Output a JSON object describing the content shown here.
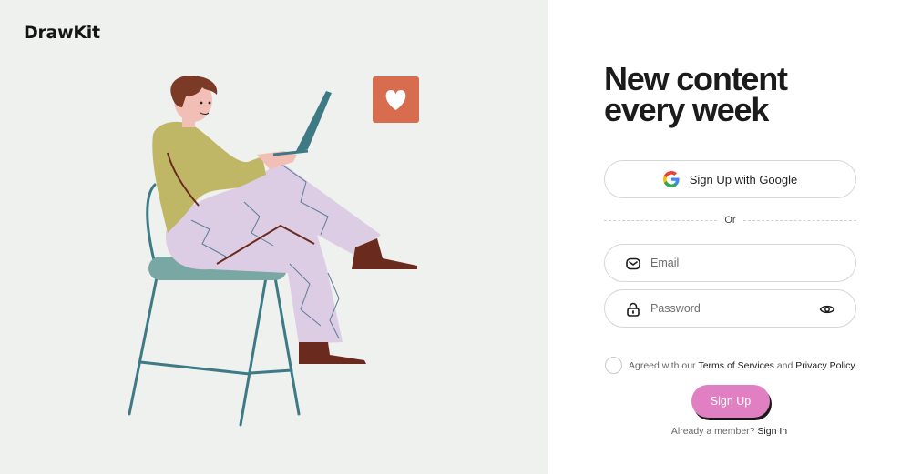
{
  "brand": {
    "logo_text": "DrawKit"
  },
  "hero": {
    "headline_line1": "New content",
    "headline_line2": "every week"
  },
  "google_button": {
    "label": "Sign Up with Google",
    "icon": "google-icon"
  },
  "divider": {
    "label": "Or"
  },
  "email": {
    "placeholder": "Email",
    "value": "",
    "icon": "mail-icon"
  },
  "password": {
    "placeholder": "Password",
    "value": "",
    "icon": "lock-icon",
    "toggle_icon": "eye-icon"
  },
  "agreement": {
    "prefix": "Agreed with our ",
    "terms": "Terms of Services",
    "middle": " and ",
    "privacy": "Privacy Policy.",
    "checked": false
  },
  "signup_button": {
    "label": "Sign Up",
    "color": "#e07fc2"
  },
  "signin": {
    "prefix": "Already a member? ",
    "link": "Sign In"
  },
  "colors": {
    "left_panel_bg": "#eff1ee",
    "heart_tile": "#d86c4e",
    "shirt": "#bfb765",
    "pants": "#dccde4",
    "chair": "#3e7a85",
    "seat": "#79a7a3",
    "shoes": "#6b2a1e",
    "hair": "#7a3a26"
  }
}
